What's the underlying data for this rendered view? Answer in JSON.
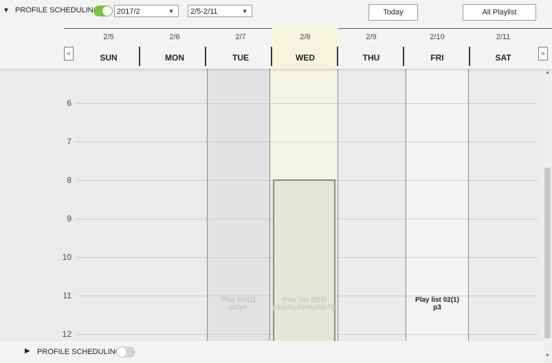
{
  "top": {
    "collapse_icon": "triangle-down",
    "title": "PROFILE SCHEDULING",
    "toggle_on": true,
    "month_select": "2017/2",
    "week_select": "2/5-2/11",
    "today_label": "Today",
    "all_playlist_label": "All Playlist"
  },
  "header": {
    "prev_label": "<",
    "next_label": ">",
    "days": [
      {
        "date": "2/5",
        "day": "SUN"
      },
      {
        "date": "2/6",
        "day": "MON"
      },
      {
        "date": "2/7",
        "day": "TUE"
      },
      {
        "date": "2/8",
        "day": "WED"
      },
      {
        "date": "2/9",
        "day": "THU"
      },
      {
        "date": "2/10",
        "day": "FRI"
      },
      {
        "date": "2/11",
        "day": "SAT"
      }
    ],
    "today_index": 3
  },
  "grid": {
    "hours": [
      "6",
      "7",
      "8",
      "9",
      "10",
      "11",
      "12"
    ],
    "events": [
      {
        "day": "TUE",
        "title": "Play list(2)",
        "items": "p2/p6"
      },
      {
        "day": "WED",
        "title": "Play list 00(8)",
        "items": "p6/p2/p3/p4/p5/p7/p"
      },
      {
        "day": "FRI",
        "title": "Play list 02(1)",
        "items": "p3"
      }
    ]
  },
  "bottom": {
    "expand_icon": "triangle-right",
    "title": "PROFILE SCHEDULING",
    "toggle_on": false
  },
  "colors": {
    "toggle_on": "#7dc143",
    "today_column": "#f5f5de",
    "background": "#ebebeb"
  }
}
